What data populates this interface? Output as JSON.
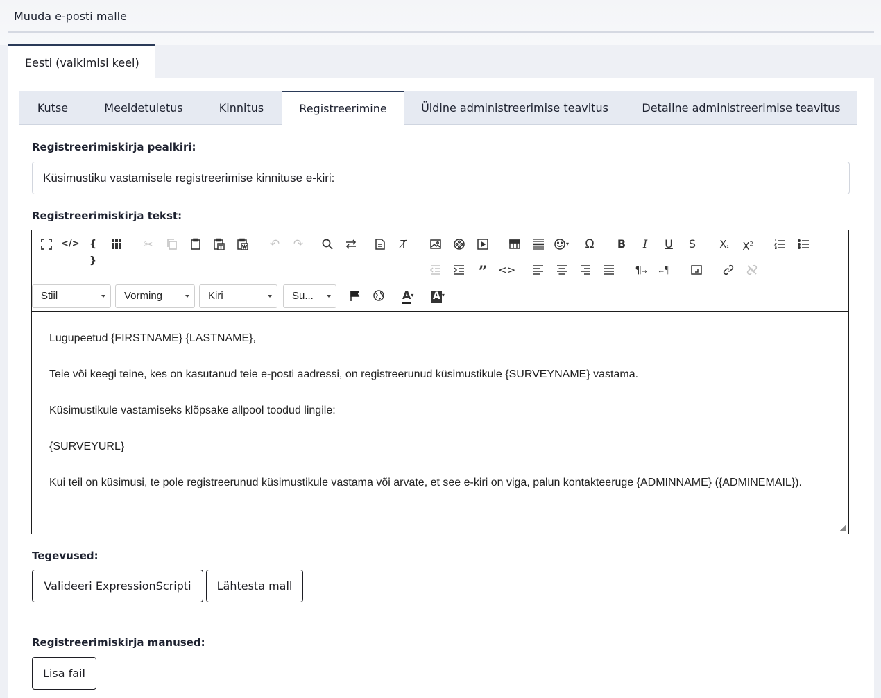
{
  "header": {
    "title": "Muuda e-posti malle"
  },
  "language_tab": {
    "label": "Eesti (vaikimisi keel)"
  },
  "tabs": [
    {
      "label": "Kutse"
    },
    {
      "label": "Meeldetuletus"
    },
    {
      "label": "Kinnitus"
    },
    {
      "label": "Registreerimine",
      "active": true
    },
    {
      "label": "Üldine administreerimise teavitus"
    },
    {
      "label": "Detailne administreerimise teavitus"
    }
  ],
  "subject": {
    "label": "Registreerimiskirja pealkiri:",
    "value": "Küsimustiku vastamisele registreerimise kinnituse e-kiri:"
  },
  "body": {
    "label": "Registreerimiskirja tekst:",
    "combos": {
      "style": "Stiil",
      "format": "Vorming",
      "font": "Kiri",
      "size": "Su..."
    },
    "toolbar_icons": [
      "maximize-icon",
      "source-icon",
      "code-braces-icon",
      "grid-icon",
      "cut-icon",
      "copy-icon",
      "paste-icon",
      "paste-text-icon",
      "paste-word-icon",
      "undo-icon",
      "redo-icon",
      "find-icon",
      "replace-icon",
      "template-icon",
      "remove-format-icon",
      "image-icon",
      "media-icon",
      "video-icon",
      "table-icon",
      "horizontal-rule-icon",
      "emoji-icon",
      "special-char-icon",
      "bold-icon",
      "italic-icon",
      "underline-icon",
      "strikethrough-icon",
      "subscript-icon",
      "superscript-icon",
      "numbered-list-icon",
      "bulleted-list-icon",
      "outdent-icon",
      "indent-icon",
      "blockquote-icon",
      "code-icon",
      "align-left-icon",
      "align-center-icon",
      "align-right-icon",
      "justify-icon",
      "ltr-icon",
      "rtl-icon",
      "iframe-icon",
      "link-icon",
      "unlink-icon",
      "anchor-flag-icon",
      "language-globe-icon",
      "text-color-icon",
      "background-color-icon"
    ],
    "paragraphs": [
      "Lugupeetud {FIRSTNAME} {LASTNAME},",
      "Teie või keegi teine, kes on kasutanud teie e-posti aadressi, on registreerunud küsimustikule {SURVEYNAME} vastama.",
      "Küsimustikule vastamiseks klõpsake allpool toodud lingile:",
      "{SURVEYURL}",
      "Kui teil on küsimusi, te pole registreerunud küsimustikule vastama või arvate, et see e-kiri on viga, palun kontakteeruge {ADMINNAME} ({ADMINEMAIL})."
    ]
  },
  "actions": {
    "label": "Tegevused:",
    "validate_label": "Valideeri ExpressionScripti",
    "reset_label": "Lähtesta mall"
  },
  "attachments": {
    "label": "Registreerimiskirja manused:",
    "add_label": "Lisa fail"
  }
}
